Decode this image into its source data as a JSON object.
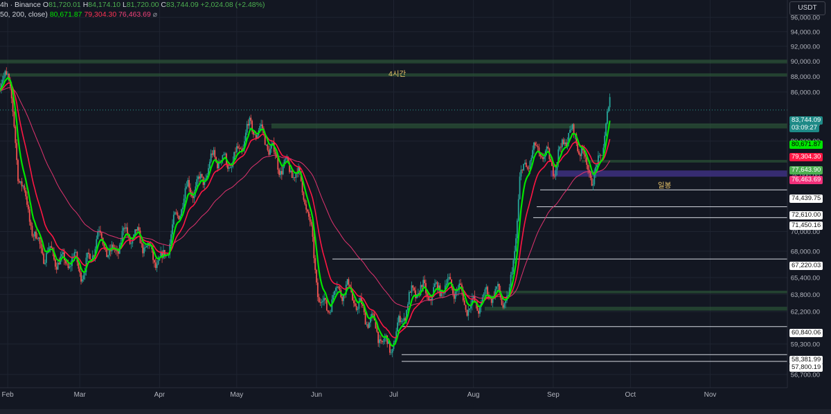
{
  "header": {
    "line1": {
      "prefix": "4h · Binance",
      "open_label": "O",
      "open": "81,720.01",
      "high_label": "H",
      "high": "84,174.10",
      "low_label": "L",
      "low": "81,720.00",
      "close_label": "C",
      "close": "83,744.09",
      "change": "+2,024.08 (+2.48%)"
    },
    "line2": {
      "params": "50, 200, close)",
      "ma1": "80,671.87",
      "ma2": "79,304.30",
      "ma3": "76,463.69",
      "icon": "hidden-eye-icon"
    }
  },
  "currency_button": "USDT",
  "annotations": {
    "zone_4h": "4시간",
    "zone_daily": "일봉"
  },
  "price_labels": {
    "last_price": "83,744.09",
    "countdown": "03:09:27",
    "ma1": "80,671.87",
    "ma2": "79,304.30",
    "level_77643": "77,643.90",
    "ma3": "76,463.69",
    "level_74439": "74,439.75",
    "level_72610": "72,610.00",
    "level_71450": "71,450.16",
    "level_67220": "67,220.03",
    "level_60840": "60,840.06",
    "level_58381": "58,381.99",
    "level_57800": "57,800.19"
  },
  "colors": {
    "background": "#131722",
    "up": "#26a69a",
    "down": "#ef5350",
    "ma_fast": "#00e600",
    "ma_mid": "#ff1744",
    "ma_slow": "#e0336f",
    "zone_green": "#2e5e3a",
    "zone_purple": "#3b2f7a"
  },
  "chart_data": {
    "type": "candlestick",
    "timeframe": "4h",
    "exchange": "Binance",
    "x_tick_labels": [
      "Feb",
      "Mar",
      "Apr",
      "May",
      "Jun",
      "Jul",
      "Aug",
      "Sep",
      "Oct",
      "Nov"
    ],
    "y_tick_labels": [
      "96,000.00",
      "94,000.00",
      "92,000.00",
      "90,000.00",
      "88,000.00",
      "86,000.00",
      "82,000.00",
      "80,000.00",
      "76,000.00",
      "70,000.00",
      "68,000.00",
      "65,400.00",
      "63,800.00",
      "62,200.00",
      "59,300.00",
      "56,700.00"
    ],
    "y_axis_scale": "log",
    "ylim": [
      55600,
      98500
    ],
    "last": {
      "open": 81720.01,
      "high": 84174.1,
      "low": 81720.0,
      "close": 83744.09,
      "change": 2024.08,
      "change_pct": 2.48
    },
    "price_path": [
      [
        "2025-01-29",
        86500
      ],
      [
        "2025-01-31",
        90000
      ],
      [
        "2025-02-01",
        89500
      ],
      [
        "2025-02-03",
        82500
      ],
      [
        "2025-02-05",
        76000
      ],
      [
        "2025-02-08",
        72500
      ],
      [
        "2025-02-12",
        69500
      ],
      [
        "2025-02-17",
        68000
      ],
      [
        "2025-02-22",
        66000
      ],
      [
        "2025-02-27",
        67500
      ],
      [
        "2025-03-03",
        66500
      ],
      [
        "2025-03-08",
        69000
      ],
      [
        "2025-03-13",
        67500
      ],
      [
        "2025-03-18",
        70500
      ],
      [
        "2025-03-22",
        69000
      ],
      [
        "2025-03-27",
        68000
      ],
      [
        "2025-04-02",
        67500
      ],
      [
        "2025-04-08",
        71000
      ],
      [
        "2025-04-12",
        74500
      ],
      [
        "2025-04-17",
        76000
      ],
      [
        "2025-04-22",
        77500
      ],
      [
        "2025-04-27",
        77000
      ],
      [
        "2025-05-02",
        79500
      ],
      [
        "2025-05-05",
        81500
      ],
      [
        "2025-05-09",
        80500
      ],
      [
        "2025-05-14",
        79500
      ],
      [
        "2025-05-19",
        77500
      ],
      [
        "2025-05-23",
        76000
      ],
      [
        "2025-05-27",
        74000
      ],
      [
        "2025-05-30",
        70000
      ],
      [
        "2025-06-02",
        64000
      ],
      [
        "2025-06-05",
        62500
      ],
      [
        "2025-06-09",
        63500
      ],
      [
        "2025-06-14",
        64500
      ],
      [
        "2025-06-18",
        63000
      ],
      [
        "2025-06-23",
        60500
      ],
      [
        "2025-06-27",
        59000
      ],
      [
        "2025-06-30",
        59500
      ],
      [
        "2025-07-04",
        62000
      ],
      [
        "2025-07-09",
        63500
      ],
      [
        "2025-07-14",
        64000
      ],
      [
        "2025-07-19",
        65000
      ],
      [
        "2025-07-24",
        64000
      ],
      [
        "2025-07-29",
        63000
      ],
      [
        "2025-08-03",
        63500
      ],
      [
        "2025-08-08",
        63500
      ],
      [
        "2025-08-12",
        63000
      ],
      [
        "2025-08-15",
        64000
      ],
      [
        "2025-08-17",
        69000
      ],
      [
        "2025-08-19",
        76000
      ],
      [
        "2025-08-23",
        77500
      ],
      [
        "2025-08-28",
        78500
      ],
      [
        "2025-09-02",
        78000
      ],
      [
        "2025-09-06",
        80500
      ],
      [
        "2025-09-10",
        79500
      ],
      [
        "2025-09-14",
        77500
      ],
      [
        "2025-09-17",
        76500
      ],
      [
        "2025-09-19",
        78000
      ],
      [
        "2025-09-21",
        81000
      ],
      [
        "2025-09-23",
        83744
      ]
    ],
    "moving_averages": [
      {
        "length": 50,
        "value": 80671.87
      },
      {
        "length": 200,
        "value": 79304.3
      },
      {
        "value": 76463.69
      }
    ],
    "horizontal_levels": [
      74439.75,
      72610.0,
      71450.16,
      67220.03,
      60840.06,
      58381.99,
      57800.19
    ],
    "zones": [
      {
        "label": "4시간",
        "from": 89700,
        "to": 90200
      },
      {
        "from": 88000,
        "to": 88400
      },
      {
        "from": 81500,
        "to": 82100
      },
      {
        "from": 77500,
        "to": 77800
      },
      {
        "label": "일봉",
        "from": 75900,
        "to": 76600
      },
      {
        "from": 63900,
        "to": 64150
      },
      {
        "from": 62300,
        "to": 62650
      }
    ],
    "grid": true
  }
}
